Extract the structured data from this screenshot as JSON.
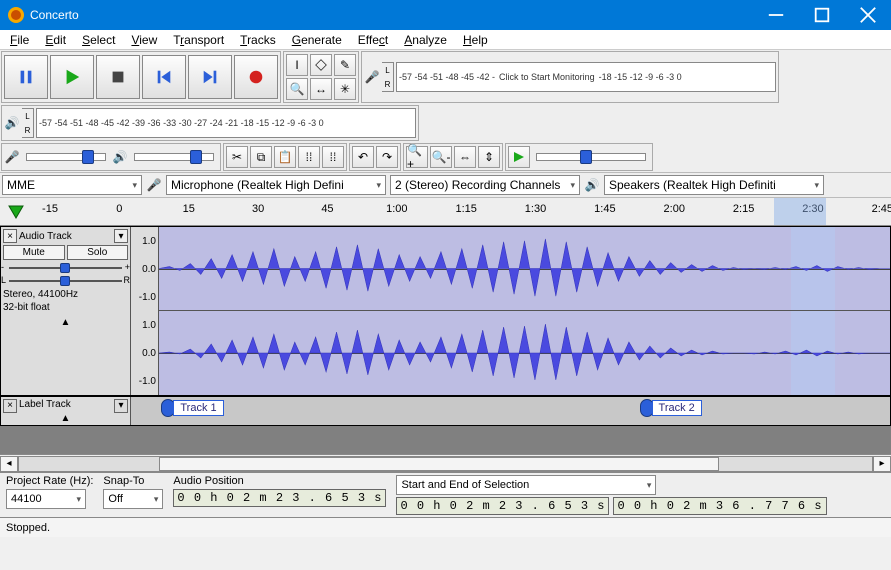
{
  "title": "Concerto",
  "menu": [
    "File",
    "Edit",
    "Select",
    "View",
    "Transport",
    "Tracks",
    "Generate",
    "Effect",
    "Analyze",
    "Help"
  ],
  "meters": {
    "rec_ticks": "-57 -54 -51 -48 -45 -42 -",
    "rec_hint": "Click to Start Monitoring",
    "rec_ticks2": "-18 -15 -12  -9  -6  -3  0",
    "play_ticks": "-57 -54 -51 -48 -45 -42 -39 -36 -33 -30 -27 -24 -21 -18 -15 -12  -9  -6  -3  0"
  },
  "devices": {
    "host": "MME",
    "input": "Microphone (Realtek High Defini",
    "channels": "2 (Stereo) Recording Channels",
    "output": "Speakers (Realtek High Definiti"
  },
  "timeline": [
    "-15",
    "0",
    "15",
    "30",
    "45",
    "1:00",
    "1:15",
    "1:30",
    "1:45",
    "2:00",
    "2:15",
    "2:30",
    "2:45"
  ],
  "audio_track": {
    "name": "Audio Track",
    "mute": "Mute",
    "solo": "Solo",
    "scale": [
      "1.0",
      "0.0",
      "-1.0"
    ],
    "info1": "Stereo, 44100Hz",
    "info2": "32-bit float",
    "gain_minus": "-",
    "gain_plus": "+",
    "pan_l": "L",
    "pan_r": "R"
  },
  "label_track": {
    "name": "Label Track",
    "labels": [
      {
        "pos_pct": 4,
        "text": "Track 1"
      },
      {
        "pos_pct": 67,
        "text": "Track 2"
      }
    ]
  },
  "selection": {
    "rate_label": "Project Rate (Hz):",
    "rate": "44100",
    "snap_label": "Snap-To",
    "snap": "Off",
    "pos_label": "Audio Position",
    "pos": "0 0 h 0 2 m 2 3 . 6 5 3 s",
    "range_label": "Start and End of Selection",
    "start": "0 0 h 0 2 m 2 3 . 6 5 3 s",
    "end": "0 0 h 0 2 m 3 6 . 7 7 6 s"
  },
  "status": "Stopped."
}
